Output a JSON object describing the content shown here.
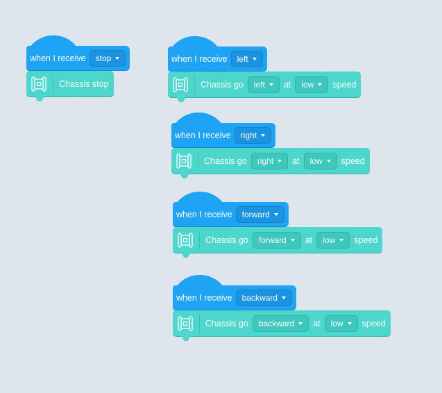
{
  "colors": {
    "event": "#1ea3f5",
    "chassis": "#4dd6cc",
    "background": "#f5f8fc"
  },
  "scripts": [
    {
      "hat": {
        "label": "when I receive",
        "message": "stop"
      },
      "action": {
        "icon": "chassis-icon",
        "text": "Chassis stop"
      }
    },
    {
      "hat": {
        "label": "when I receive",
        "message": "left"
      },
      "action": {
        "icon": "chassis-icon",
        "text": "Chassis go",
        "direction": "left",
        "at": "at",
        "speed": "low",
        "suffix": "speed"
      }
    },
    {
      "hat": {
        "label": "when I receive",
        "message": "right"
      },
      "action": {
        "icon": "chassis-icon",
        "text": "Chassis go",
        "direction": "right",
        "at": "at",
        "speed": "low",
        "suffix": "speed"
      }
    },
    {
      "hat": {
        "label": "when I receive",
        "message": "forward"
      },
      "action": {
        "icon": "chassis-icon",
        "text": "Chassis go",
        "direction": "forward",
        "at": "at",
        "speed": "low",
        "suffix": "speed"
      }
    },
    {
      "hat": {
        "label": "when I receive",
        "message": "backward"
      },
      "action": {
        "icon": "chassis-icon",
        "text": "Chassis go",
        "direction": "backward",
        "at": "at",
        "speed": "low",
        "suffix": "speed"
      }
    }
  ]
}
